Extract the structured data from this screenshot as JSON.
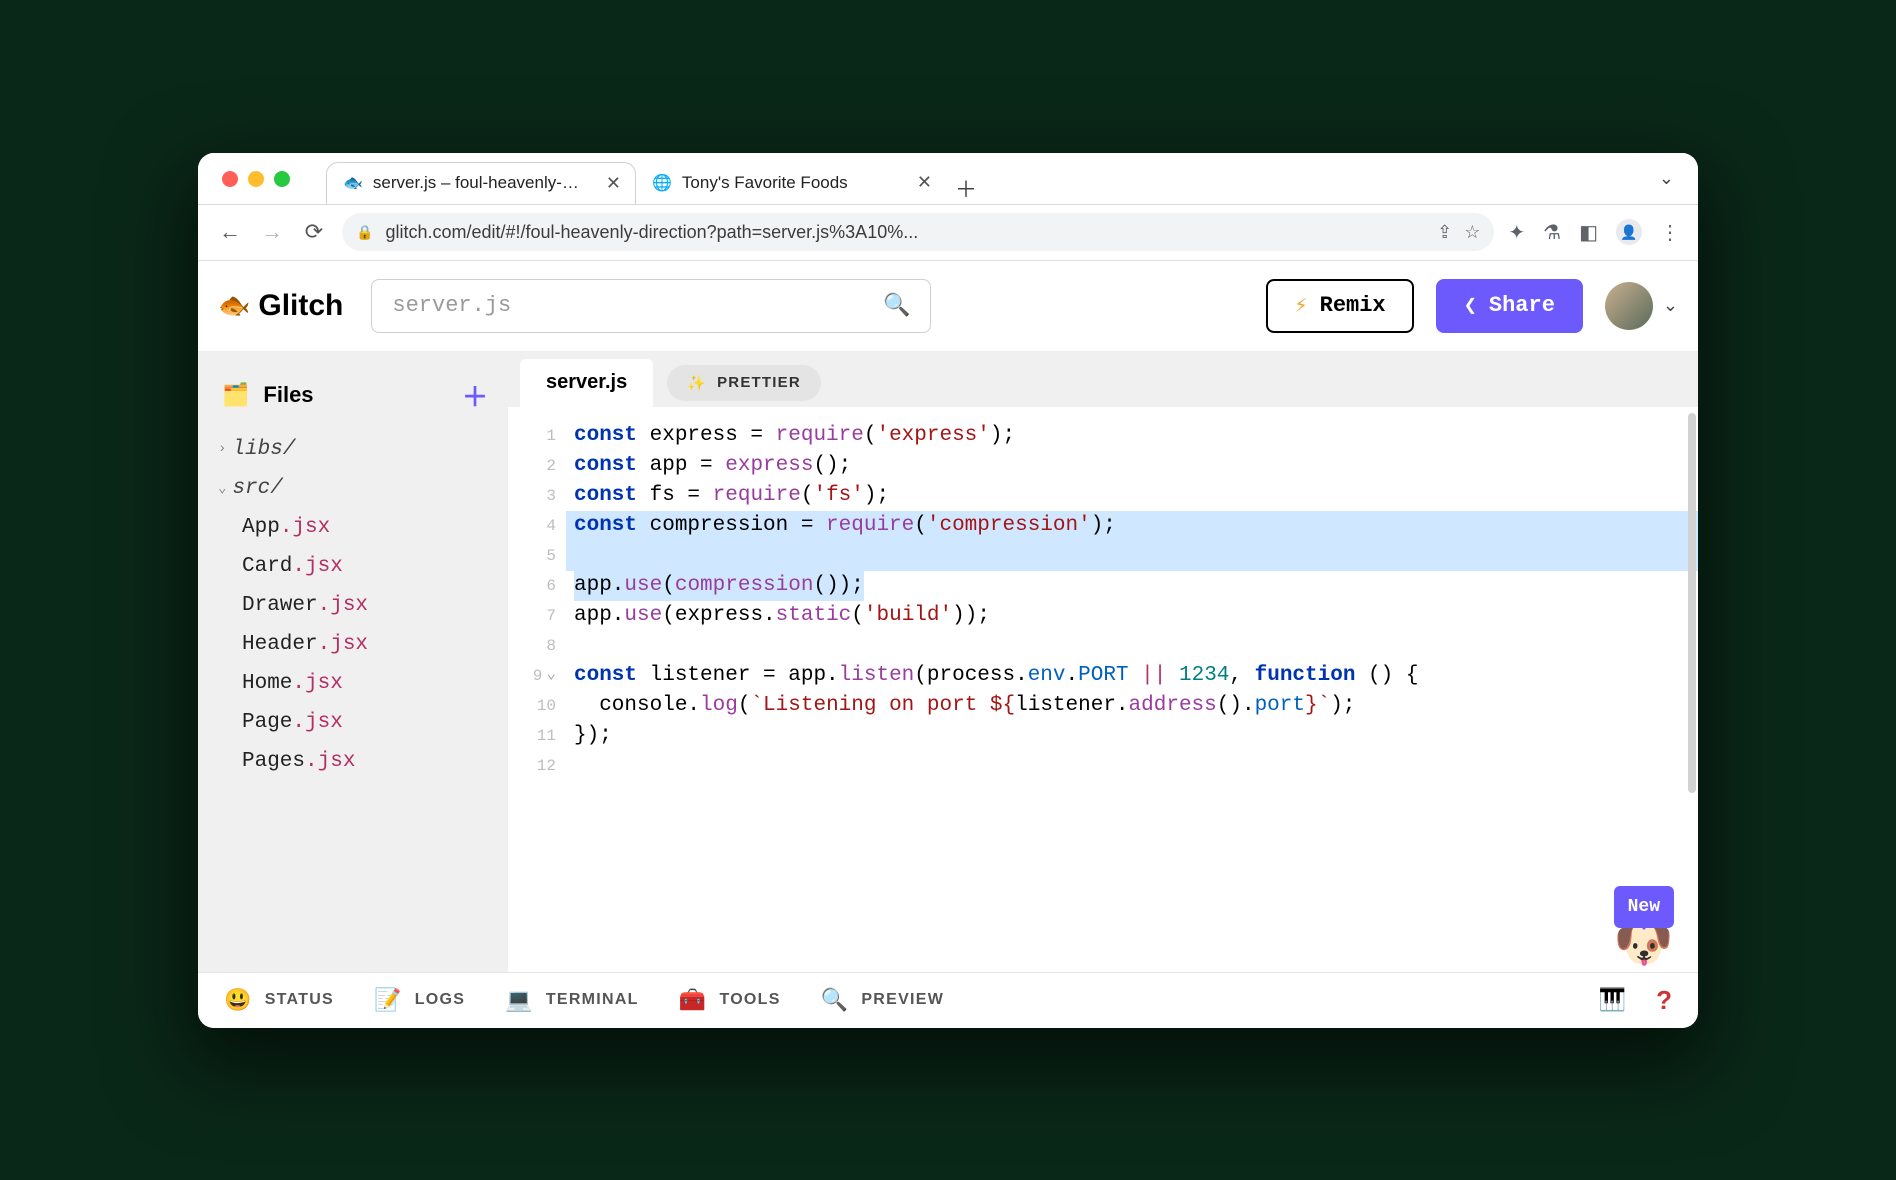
{
  "browser": {
    "tabs": [
      {
        "title": "server.js – foul-heavenly-direct",
        "active": true,
        "favicon": "🐟"
      },
      {
        "title": "Tony's Favorite Foods",
        "active": false,
        "favicon": "🌐"
      }
    ],
    "url": "glitch.com/edit/#!/foul-heavenly-direction?path=server.js%3A10%..."
  },
  "header": {
    "logo": "Glitch",
    "search_placeholder": "server.js",
    "remix": "Remix",
    "share": "Share"
  },
  "sidebar": {
    "title": "Files",
    "folders": [
      {
        "name": "libs/",
        "expanded": false
      },
      {
        "name": "src/",
        "expanded": true
      }
    ],
    "files": [
      {
        "name": "App",
        "ext": ".jsx"
      },
      {
        "name": "Card",
        "ext": ".jsx"
      },
      {
        "name": "Drawer",
        "ext": ".jsx"
      },
      {
        "name": "Header",
        "ext": ".jsx"
      },
      {
        "name": "Home",
        "ext": ".jsx"
      },
      {
        "name": "Page",
        "ext": ".jsx"
      },
      {
        "name": "Pages",
        "ext": ".jsx"
      }
    ]
  },
  "editor": {
    "tab": "server.js",
    "prettier": "PRETTIER",
    "lines": [
      {
        "n": 1,
        "tokens": [
          [
            "kw",
            "const"
          ],
          [
            "",
            " express = "
          ],
          [
            "fn",
            "require"
          ],
          [
            "",
            "("
          ],
          [
            "str",
            "'express'"
          ],
          [
            "",
            ");"
          ]
        ]
      },
      {
        "n": 2,
        "tokens": [
          [
            "kw",
            "const"
          ],
          [
            "",
            " app = "
          ],
          [
            "fn",
            "express"
          ],
          [
            "",
            "();"
          ]
        ]
      },
      {
        "n": 3,
        "tokens": [
          [
            "kw",
            "const"
          ],
          [
            "",
            " fs = "
          ],
          [
            "fn",
            "require"
          ],
          [
            "",
            "("
          ],
          [
            "str",
            "'fs'"
          ],
          [
            "",
            ");"
          ]
        ]
      },
      {
        "n": 4,
        "hl": true,
        "tokens": [
          [
            "kw",
            "const"
          ],
          [
            "",
            " compression = "
          ],
          [
            "fn",
            "require"
          ],
          [
            "",
            "("
          ],
          [
            "str",
            "'compression'"
          ],
          [
            "",
            ");"
          ]
        ]
      },
      {
        "n": 5,
        "hl": true,
        "tokens": []
      },
      {
        "n": 6,
        "hl": "partial",
        "tokens": [
          [
            "",
            "app."
          ],
          [
            "fn",
            "use"
          ],
          [
            "",
            "("
          ],
          [
            "fn",
            "compression"
          ],
          [
            "",
            "());"
          ]
        ]
      },
      {
        "n": 7,
        "tokens": [
          [
            "",
            "app."
          ],
          [
            "fn",
            "use"
          ],
          [
            "",
            "(express."
          ],
          [
            "fn",
            "static"
          ],
          [
            "",
            "("
          ],
          [
            "str",
            "'build'"
          ],
          [
            "",
            "));"
          ]
        ]
      },
      {
        "n": 8,
        "tokens": []
      },
      {
        "n": 9,
        "fold": true,
        "tokens": [
          [
            "kw",
            "const"
          ],
          [
            "",
            " listener = app."
          ],
          [
            "fn",
            "listen"
          ],
          [
            "",
            "(process."
          ],
          [
            "prop",
            "env"
          ],
          [
            "",
            "."
          ],
          [
            "prop",
            "PORT"
          ],
          [
            "",
            " "
          ],
          [
            "op",
            "||"
          ],
          [
            "",
            " "
          ],
          [
            "num",
            "1234"
          ],
          [
            "",
            ", "
          ],
          [
            "kw",
            "function"
          ],
          [
            "",
            " () {"
          ]
        ]
      },
      {
        "n": 10,
        "tokens": [
          [
            "",
            "  console."
          ],
          [
            "fn",
            "log"
          ],
          [
            "",
            "("
          ],
          [
            "str",
            "`Listening on port ${"
          ],
          [
            "",
            "listener."
          ],
          [
            "fn",
            "address"
          ],
          [
            "",
            "()."
          ],
          [
            "prop",
            "port"
          ],
          [
            "str",
            "}`"
          ],
          [
            "",
            ");"
          ]
        ]
      },
      {
        "n": 11,
        "tokens": [
          [
            "",
            "});"
          ]
        ]
      },
      {
        "n": 12,
        "tokens": []
      }
    ],
    "mascot_badge": "New"
  },
  "footer": {
    "items": [
      {
        "icon": "😃",
        "label": "STATUS"
      },
      {
        "icon": "📝",
        "label": "LOGS"
      },
      {
        "icon": "💻",
        "label": "TERMINAL"
      },
      {
        "icon": "🧰",
        "label": "TOOLS"
      },
      {
        "icon": "🔍",
        "label": "PREVIEW"
      }
    ]
  }
}
